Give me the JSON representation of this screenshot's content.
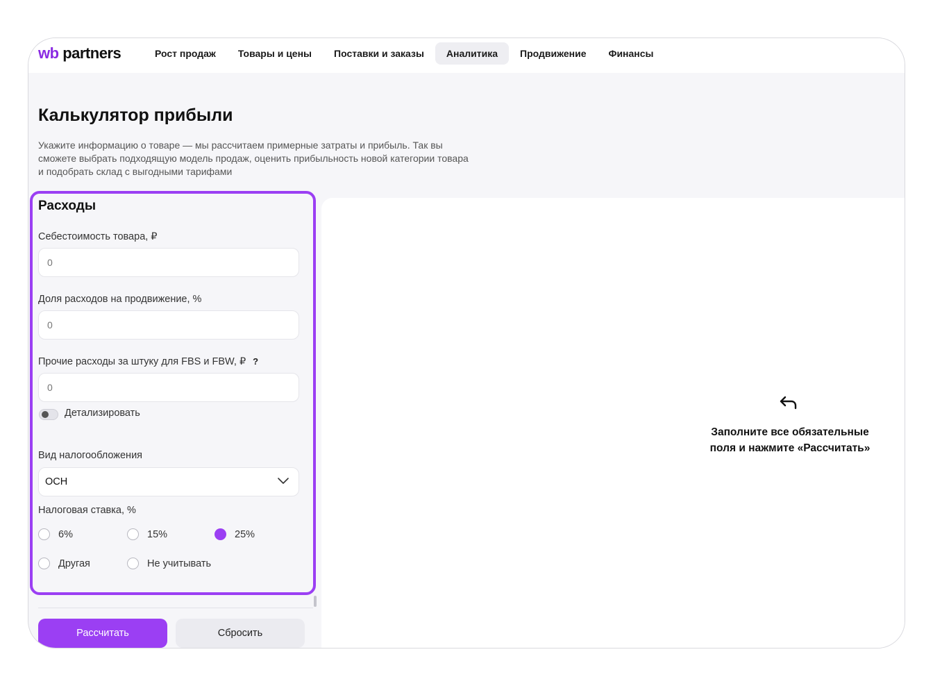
{
  "logo": {
    "wb": "wb",
    "name": "partners"
  },
  "nav": {
    "items": [
      {
        "label": "Рост продаж"
      },
      {
        "label": "Товары и цены"
      },
      {
        "label": "Поставки и заказы"
      },
      {
        "label": "Аналитика",
        "active": true
      },
      {
        "label": "Продвижение"
      },
      {
        "label": "Финансы"
      }
    ]
  },
  "page": {
    "title": "Калькулятор прибыли",
    "description": "Укажите информацию о товаре — мы рассчитаем примерные затраты и прибыль. Так вы сможете выбрать подходящую модель продаж, оценить прибыльность новой категории товара и подобрать склад с выгодными тарифами"
  },
  "expenses": {
    "title": "Расходы",
    "cost": {
      "label": "Себестоимость товара, ₽",
      "placeholder": "0"
    },
    "promo": {
      "label": "Доля расходов на продвижение, %",
      "placeholder": "0"
    },
    "other": {
      "label": "Прочие расходы за штуку для FBS и FBW, ₽",
      "help": "?",
      "placeholder": "0"
    },
    "detail_toggle": {
      "label": "Детализировать",
      "on": false
    },
    "tax_type": {
      "label": "Вид налогообложения",
      "value": "ОСН"
    },
    "tax_rate": {
      "label": "Налоговая ставка, %",
      "options": [
        {
          "label": "6%",
          "checked": false
        },
        {
          "label": "15%",
          "checked": false
        },
        {
          "label": "25%",
          "checked": true
        },
        {
          "label": "Другая",
          "checked": false
        },
        {
          "label": "Не учитывать",
          "checked": false
        }
      ]
    }
  },
  "actions": {
    "calculate": "Рассчитать",
    "reset": "Сбросить"
  },
  "hint": {
    "text": "Заполните все обязательные поля и нажмите «Рассчитать»",
    "icon": "return-arrow-icon"
  },
  "colors": {
    "accent": "#9b3ff3",
    "highlight_border": "#9b3ff3"
  }
}
